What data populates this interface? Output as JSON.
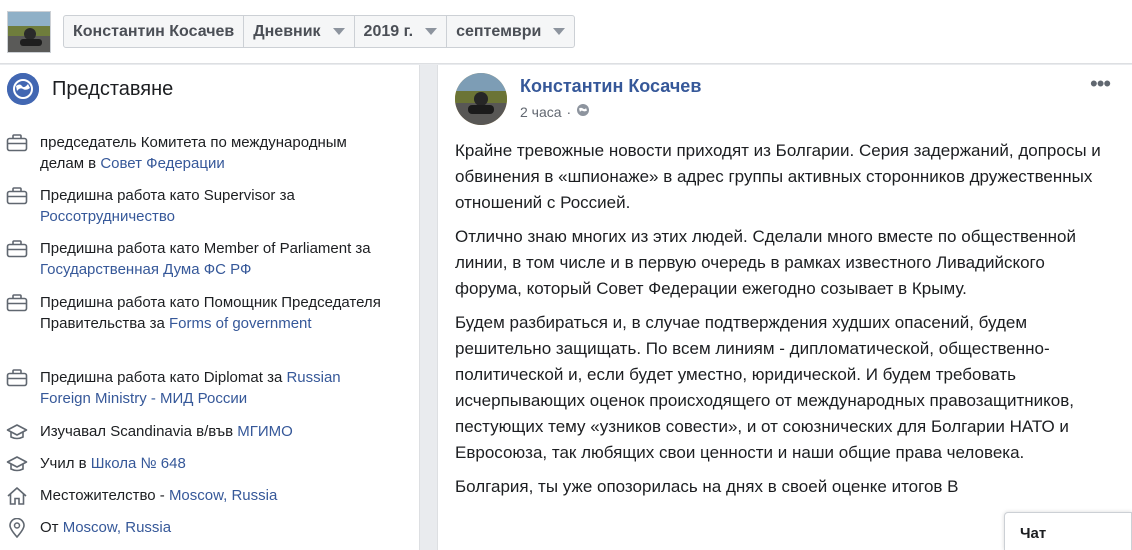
{
  "header": {
    "profile_name": "Константин Косачев",
    "section": "Дневник",
    "year": "2019 г.",
    "month": "септември"
  },
  "intro": {
    "title": "Представяне",
    "rows": [
      {
        "icon": "briefcase-icon",
        "text": "председатель Комитета по международным делам в ",
        "link": "Совет Федерации"
      },
      {
        "icon": "briefcase-icon",
        "text": "Предишна работа като Supervisor за ",
        "link": "Россотрудничество"
      },
      {
        "icon": "briefcase-icon",
        "text": "Предишна работа като Member of Parliament за ",
        "link": "Государственная Дума ФС РФ"
      },
      {
        "icon": "briefcase-icon",
        "text": "Предишна работа като Помощник Председателя Правительства за ",
        "link": "Forms of government"
      },
      {
        "icon": "briefcase-icon",
        "text": "Предишна работа като Diplomat за ",
        "link": "Russian Foreign Ministry - МИД России"
      },
      {
        "icon": "graduation-cap-icon",
        "text": "Изучавал Scandinavia в/във ",
        "link": "МГИМО"
      },
      {
        "icon": "graduation-cap-icon",
        "text": "Учил в ",
        "link": "Школа № 648"
      },
      {
        "icon": "home-icon",
        "text": "Местожителство - ",
        "link": "Moscow, Russia"
      },
      {
        "icon": "location-pin-icon",
        "text": "От ",
        "link": "Moscow, Russia"
      }
    ]
  },
  "post": {
    "author": "Константин Косачев",
    "time": "2 часа",
    "privacy_icon": "globe-icon",
    "more_label": "•••",
    "paragraphs": [
      "Крайне тревожные новости приходят из Болгарии. Серия задержаний, допросы и обвинения в «шпионаже» в адрес группы активных сторонников дружественных отношений с Россией.",
      "Отлично знаю многих из этих людей. Сделали много вместе по общественной линии, в том числе и в первую очередь в рамках известного Ливадийского форума, который Совет Федерации ежегодно созывает в Крыму.",
      "Будем разбираться и, в случае подтверждения худших опасений, будем решительно защищать. По всем линиям - дипломатической, общественно-политической и, если будет уместно, юридической. И будем требовать исчерпывающих оценок происходящего от международных правозащитников, пестующих тему «узников совести», и от союзнических для Болгарии НАТО и Евросоюза, так любящих свои ценности и наши общие права человека.",
      "Болгария, ты уже опозорилась на днях в своей оценке итогов В"
    ]
  },
  "chat": {
    "label": "Чат"
  },
  "colors": {
    "link": "#365899",
    "accent": "#4267b2",
    "text": "#1c1e21",
    "muted": "#616770"
  }
}
